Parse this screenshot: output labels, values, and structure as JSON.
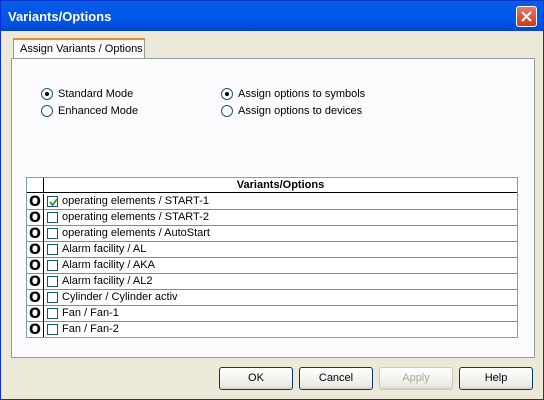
{
  "window": {
    "title": "Variants/Options"
  },
  "tabs": [
    {
      "label": "Assign Variants / Options"
    }
  ],
  "mode_options": [
    {
      "label": "Standard Mode",
      "selected": true
    },
    {
      "label": "Enhanced Mode",
      "selected": false
    }
  ],
  "assign_options": [
    {
      "label": "Assign options to symbols",
      "selected": true
    },
    {
      "label": "Assign options to devices",
      "selected": false
    }
  ],
  "grid": {
    "header": "Variants/Options",
    "rows": [
      {
        "marker": "O",
        "label": "operating elements / START-1",
        "checked": true
      },
      {
        "marker": "O",
        "label": "operating elements / START-2",
        "checked": false
      },
      {
        "marker": "O",
        "label": "operating elements / AutoStart",
        "checked": false
      },
      {
        "marker": "O",
        "label": "Alarm facility / AL",
        "checked": false
      },
      {
        "marker": "O",
        "label": "Alarm facility / AKA",
        "checked": false
      },
      {
        "marker": "O",
        "label": "Alarm facility / AL2",
        "checked": false
      },
      {
        "marker": "O",
        "label": "Cylinder / Cylinder activ",
        "checked": false
      },
      {
        "marker": "O",
        "label": "Fan / Fan-1",
        "checked": false
      },
      {
        "marker": "O",
        "label": "Fan / Fan-2",
        "checked": false
      }
    ]
  },
  "buttons": {
    "ok": "OK",
    "cancel": "Cancel",
    "apply": "Apply",
    "help": "Help"
  }
}
